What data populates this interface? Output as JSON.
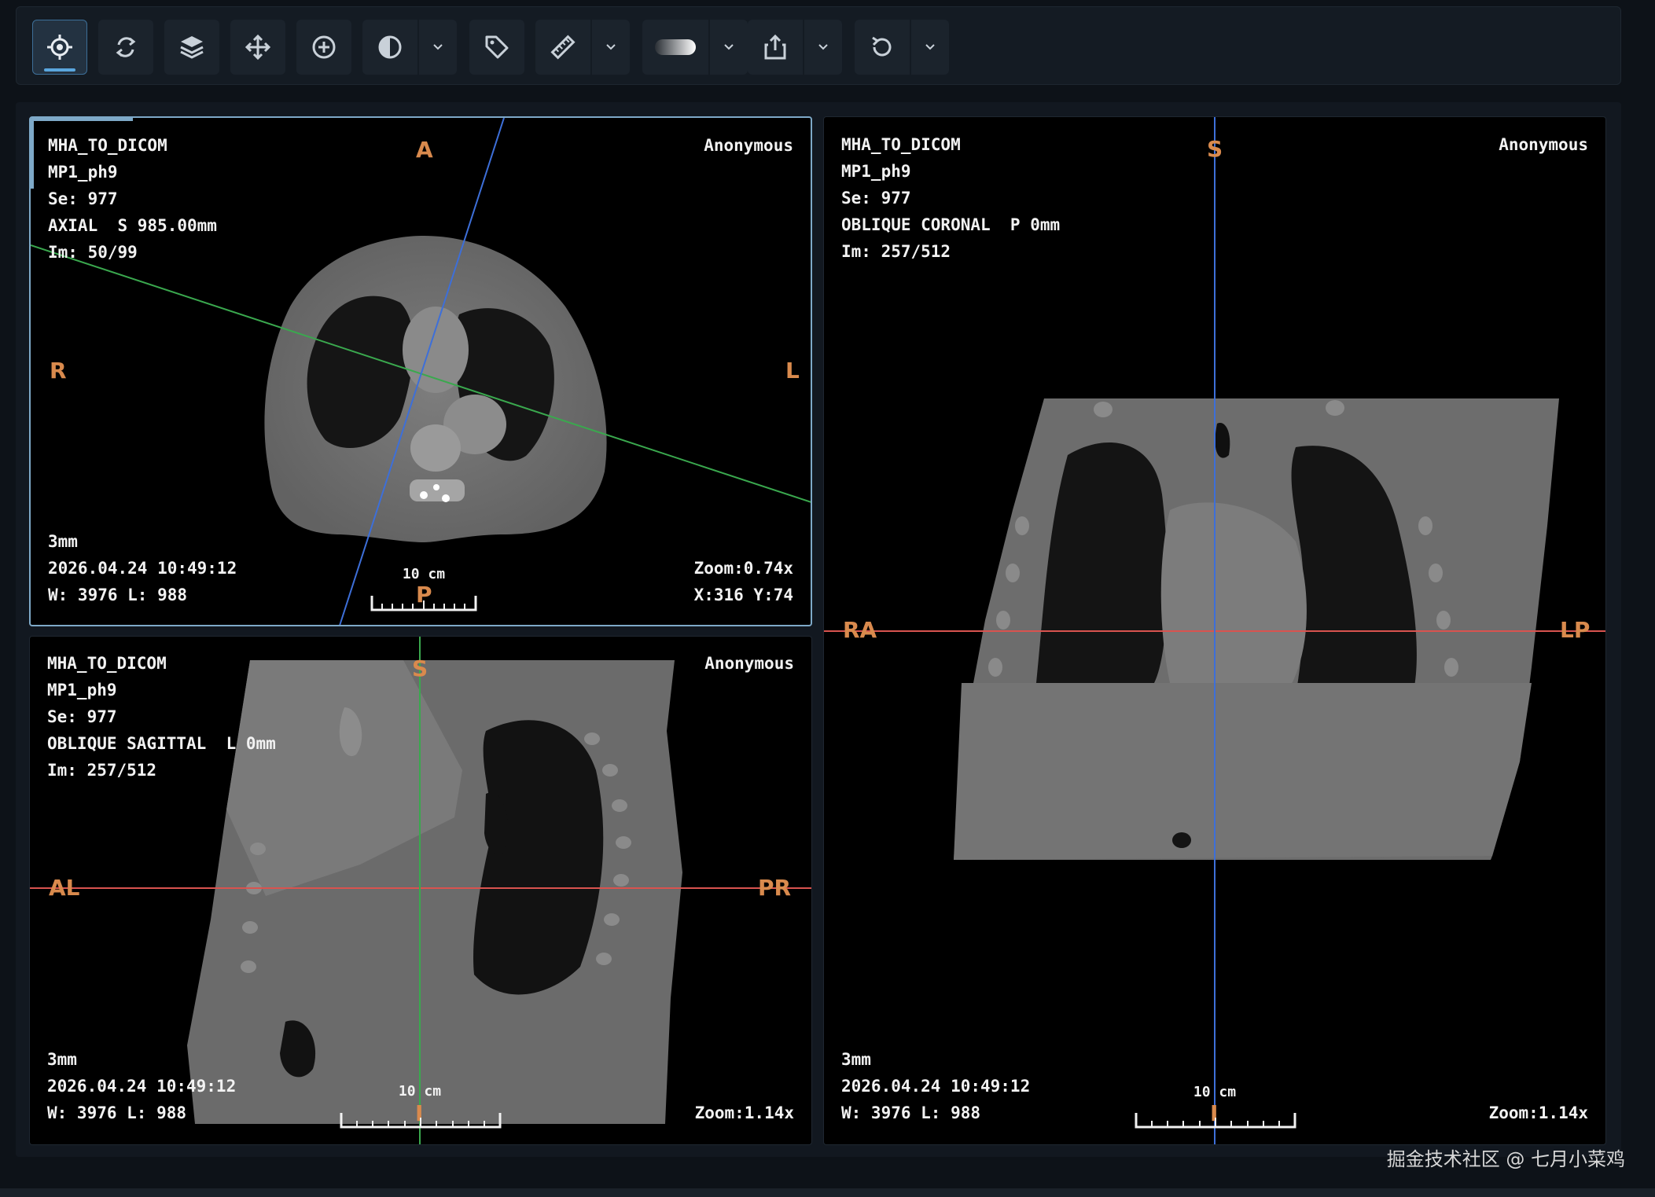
{
  "toolbar": {
    "tools": [
      {
        "name": "crosshairs-tool",
        "icon": "crosshairs-icon",
        "active": true
      },
      {
        "name": "rotate-tool",
        "icon": "rotate-arrows-icon"
      },
      {
        "name": "layers-tool",
        "icon": "layers-icon"
      },
      {
        "name": "pan-tool",
        "icon": "move-arrows-icon"
      },
      {
        "name": "zoom-tool",
        "icon": "zoom-in-icon"
      },
      {
        "name": "window-level-tool",
        "icon": "contrast-icon",
        "dropdown": true
      },
      {
        "name": "annotate-tool",
        "icon": "tag-icon"
      },
      {
        "name": "measure-tool",
        "icon": "ruler-icon",
        "dropdown": true
      },
      {
        "name": "render-preset-tool",
        "icon": "gradient-slab-icon",
        "dropdown": true
      },
      {
        "name": "export-tool",
        "icon": "share-icon",
        "dropdown": true
      },
      {
        "name": "reset-tool",
        "icon": "reset-icon",
        "dropdown": true
      }
    ]
  },
  "colors": {
    "accent": "#5aa6de",
    "orientation_label": "#d98a4d",
    "axial_line": "#3d6fd9",
    "coronal_line": "#3aa84e",
    "sagittal_line": "#d9534f"
  },
  "viewports": {
    "axial": {
      "series_title": "MHA_TO_DICOM",
      "protocol": "MP1_ph9",
      "series": "Se: 977",
      "plane": "AXIAL  S 985.00mm",
      "image": "Im: 50/99",
      "patient": "Anonymous",
      "thickness": "3mm",
      "datetime": "2026.04.24 10:49:12",
      "window_level": "W: 3976 L: 988",
      "zoom": "Zoom:0.74x",
      "cursor": "X:316 Y:74",
      "scale": "10 cm",
      "orient_top": "A",
      "orient_left": "R",
      "orient_right": "L",
      "orient_bottom": "P"
    },
    "sagittal": {
      "series_title": "MHA_TO_DICOM",
      "protocol": "MP1_ph9",
      "series": "Se: 977",
      "plane": "OBLIQUE SAGITTAL  L 0mm",
      "image": "Im: 257/512",
      "patient": "Anonymous",
      "thickness": "3mm",
      "datetime": "2026.04.24 10:49:12",
      "window_level": "W: 3976 L: 988",
      "zoom": "Zoom:1.14x",
      "scale": "10 cm",
      "orient_top": "S",
      "orient_left": "AL",
      "orient_right": "PR",
      "orient_bottom": "I"
    },
    "coronal": {
      "series_title": "MHA_TO_DICOM",
      "protocol": "MP1_ph9",
      "series": "Se: 977",
      "plane": "OBLIQUE CORONAL  P 0mm",
      "image": "Im: 257/512",
      "patient": "Anonymous",
      "thickness": "3mm",
      "datetime": "2026.04.24 10:49:12",
      "window_level": "W: 3976 L: 988",
      "zoom": "Zoom:1.14x",
      "scale": "10 cm",
      "orient_top": "S",
      "orient_left": "RA",
      "orient_right": "LP",
      "orient_bottom": "I"
    }
  },
  "watermark": "掘金技术社区 @ 七月小菜鸡"
}
